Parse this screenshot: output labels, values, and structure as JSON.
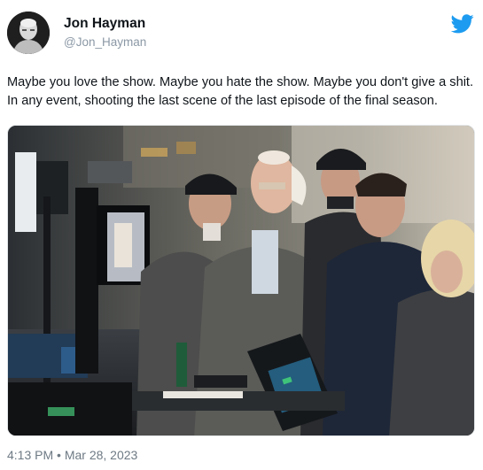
{
  "tweet": {
    "display_name": "Jon Hayman",
    "handle": "@Jon_Hayman",
    "text": "Maybe you love the show. Maybe you hate the show. Maybe you don't give a shit. In any event, shooting the last scene of the last episode of the final season.",
    "timestamp": "4:13 PM • Mar 28, 2023"
  },
  "colors": {
    "twitter_blue": "#1d9bf0",
    "text_primary": "#0f1419",
    "text_secondary": "#6e7a84"
  },
  "icons": {
    "brand": "twitter-bird-icon"
  }
}
